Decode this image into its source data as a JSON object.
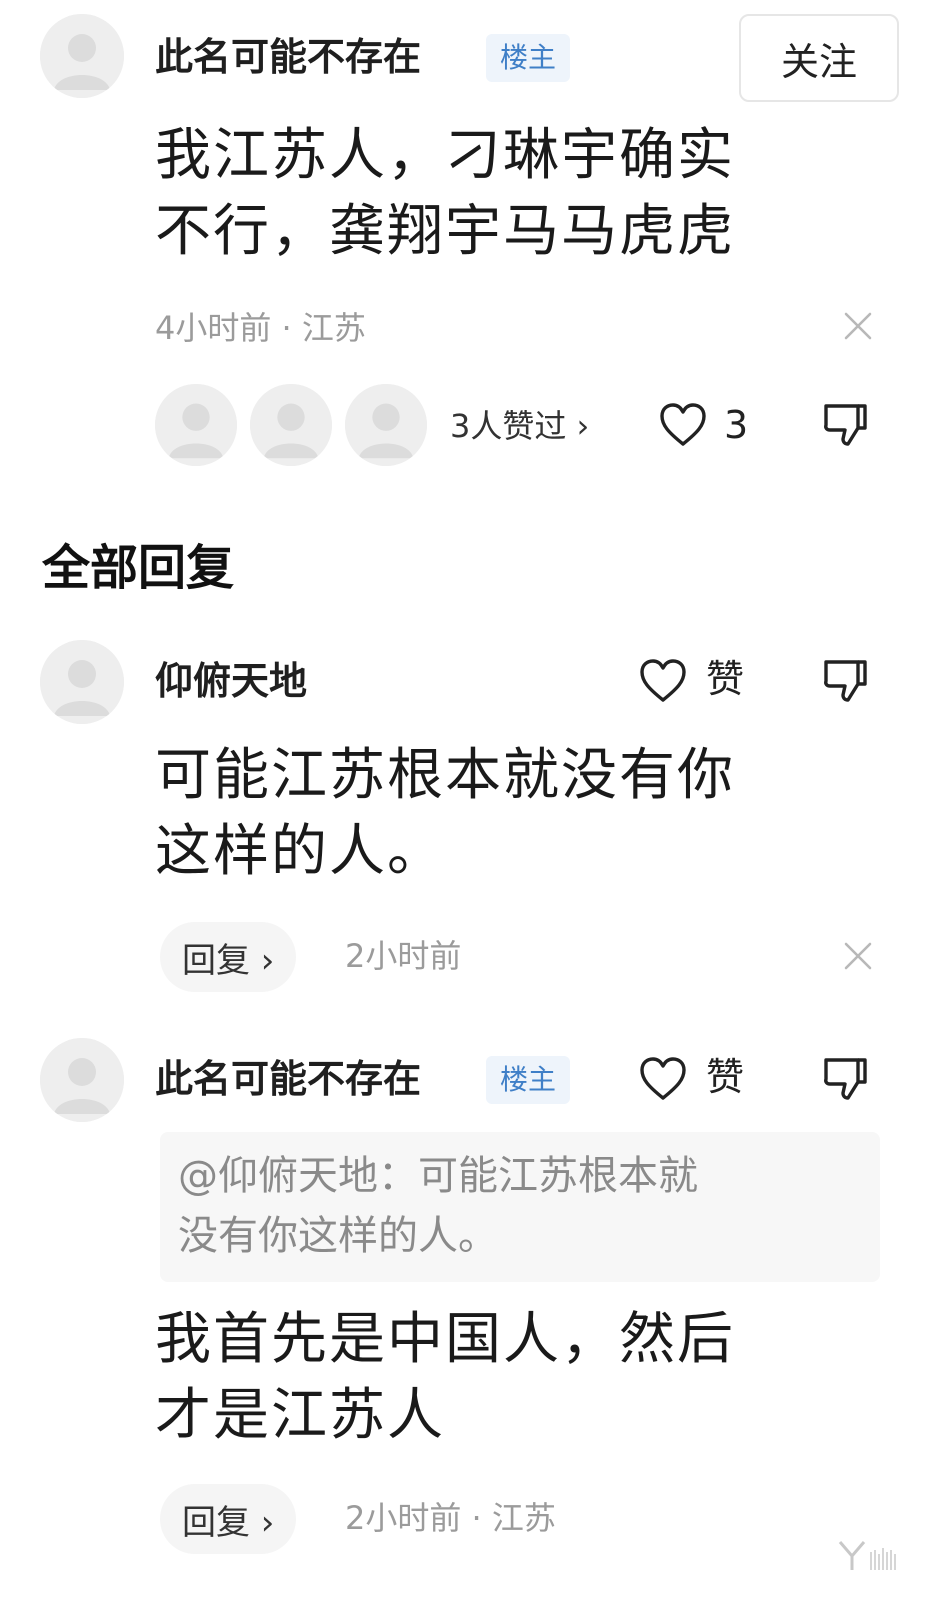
{
  "main_comment": {
    "username": "此名可能不存在",
    "op_badge": "楼主",
    "follow_label": "关注",
    "text": "我江苏人，刁琳宇确实\n不行，龚翔宇马马虎虎",
    "meta": "4小时前 · 江苏",
    "likers_text": "3人赞过 ›",
    "like_count": "3"
  },
  "section": {
    "all_replies_heading": "全部回复"
  },
  "replies": [
    {
      "username": "仰俯天地",
      "like_label": "赞",
      "text": "可能江苏根本就没有你\n这样的人。",
      "reply_label": "回复 ›",
      "meta": "2小时前"
    },
    {
      "username": "此名可能不存在",
      "op_badge": "楼主",
      "like_label": "赞",
      "quote": "@仰俯天地：可能江苏根本就\n没有你这样的人。",
      "text": "我首先是中国人，然后\n才是江苏人",
      "reply_label": "回复 ›",
      "meta": "2小时前 · 江苏"
    }
  ],
  "icons": {
    "avatar": "default-avatar-icon",
    "like": "heart-outline-icon",
    "dislike": "thumbs-down-outline-icon",
    "close": "close-icon"
  },
  "colors": {
    "op_badge_text": "#3f7fc7",
    "op_badge_bg": "#eef4fb",
    "meta_text": "#9b9b9b",
    "quote_bg": "#f7f7f7"
  }
}
